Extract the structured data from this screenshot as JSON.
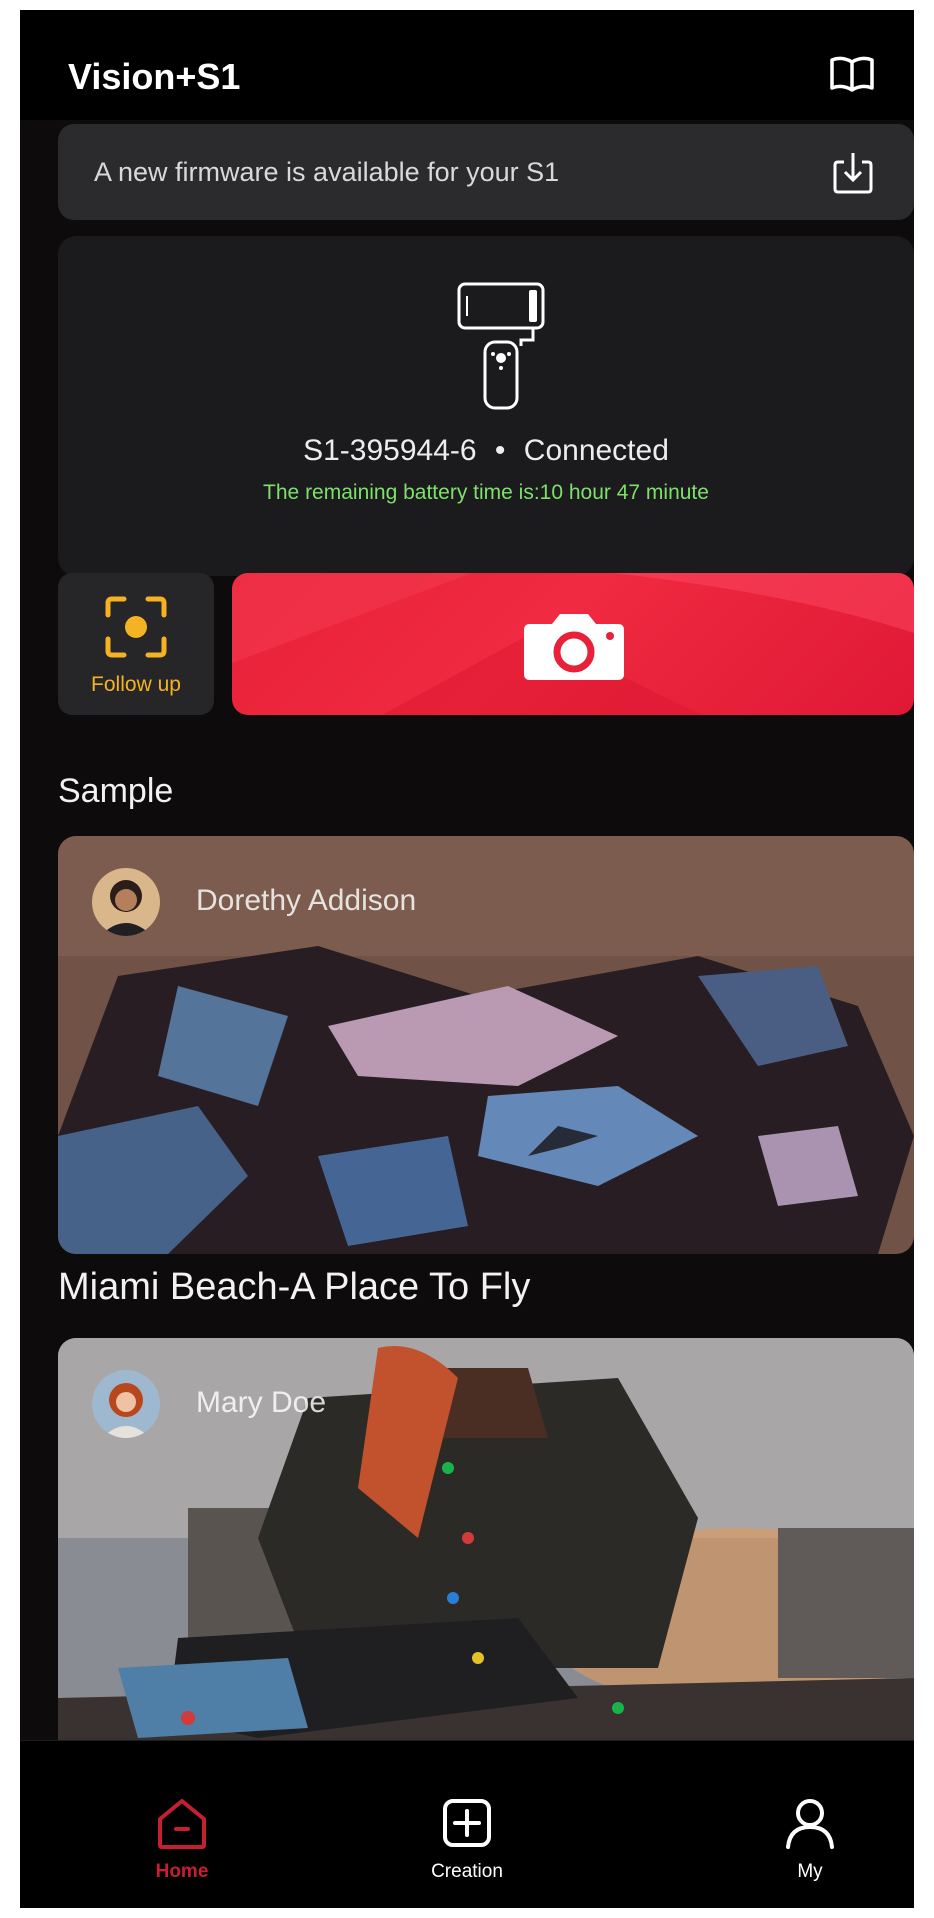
{
  "header": {
    "title": "Vision+S1",
    "guide_icon": "book-icon"
  },
  "firmware_banner": {
    "text": "A new firmware is available for your S1",
    "icon": "download-icon"
  },
  "device": {
    "icon": "gimbal-icon",
    "name": "S1-395944-6",
    "separator": "•",
    "status": "Connected",
    "battery_text": "The remaining battery time is:10 hour 47 minute"
  },
  "controls": {
    "follow_label": "Follow up",
    "follow_icon": "focus-target-icon",
    "shutter_icon": "camera-icon"
  },
  "samples": {
    "title": "Sample",
    "items": [
      {
        "author": "Dorethy Addison",
        "caption": "Miami Beach-A Place To Fly"
      },
      {
        "author": "Mary Doe",
        "caption": ""
      }
    ]
  },
  "bottom_nav": {
    "items": [
      {
        "label": "Home",
        "icon": "home-icon",
        "active": true
      },
      {
        "label": "Creation",
        "icon": "plus-square-icon",
        "active": false
      },
      {
        "label": "My",
        "icon": "user-icon",
        "active": false
      }
    ]
  },
  "colors": {
    "accent": "#e8213a",
    "battery_text": "#7ee06b",
    "follow_label": "#f5b323",
    "background": "#0d0b0c"
  }
}
